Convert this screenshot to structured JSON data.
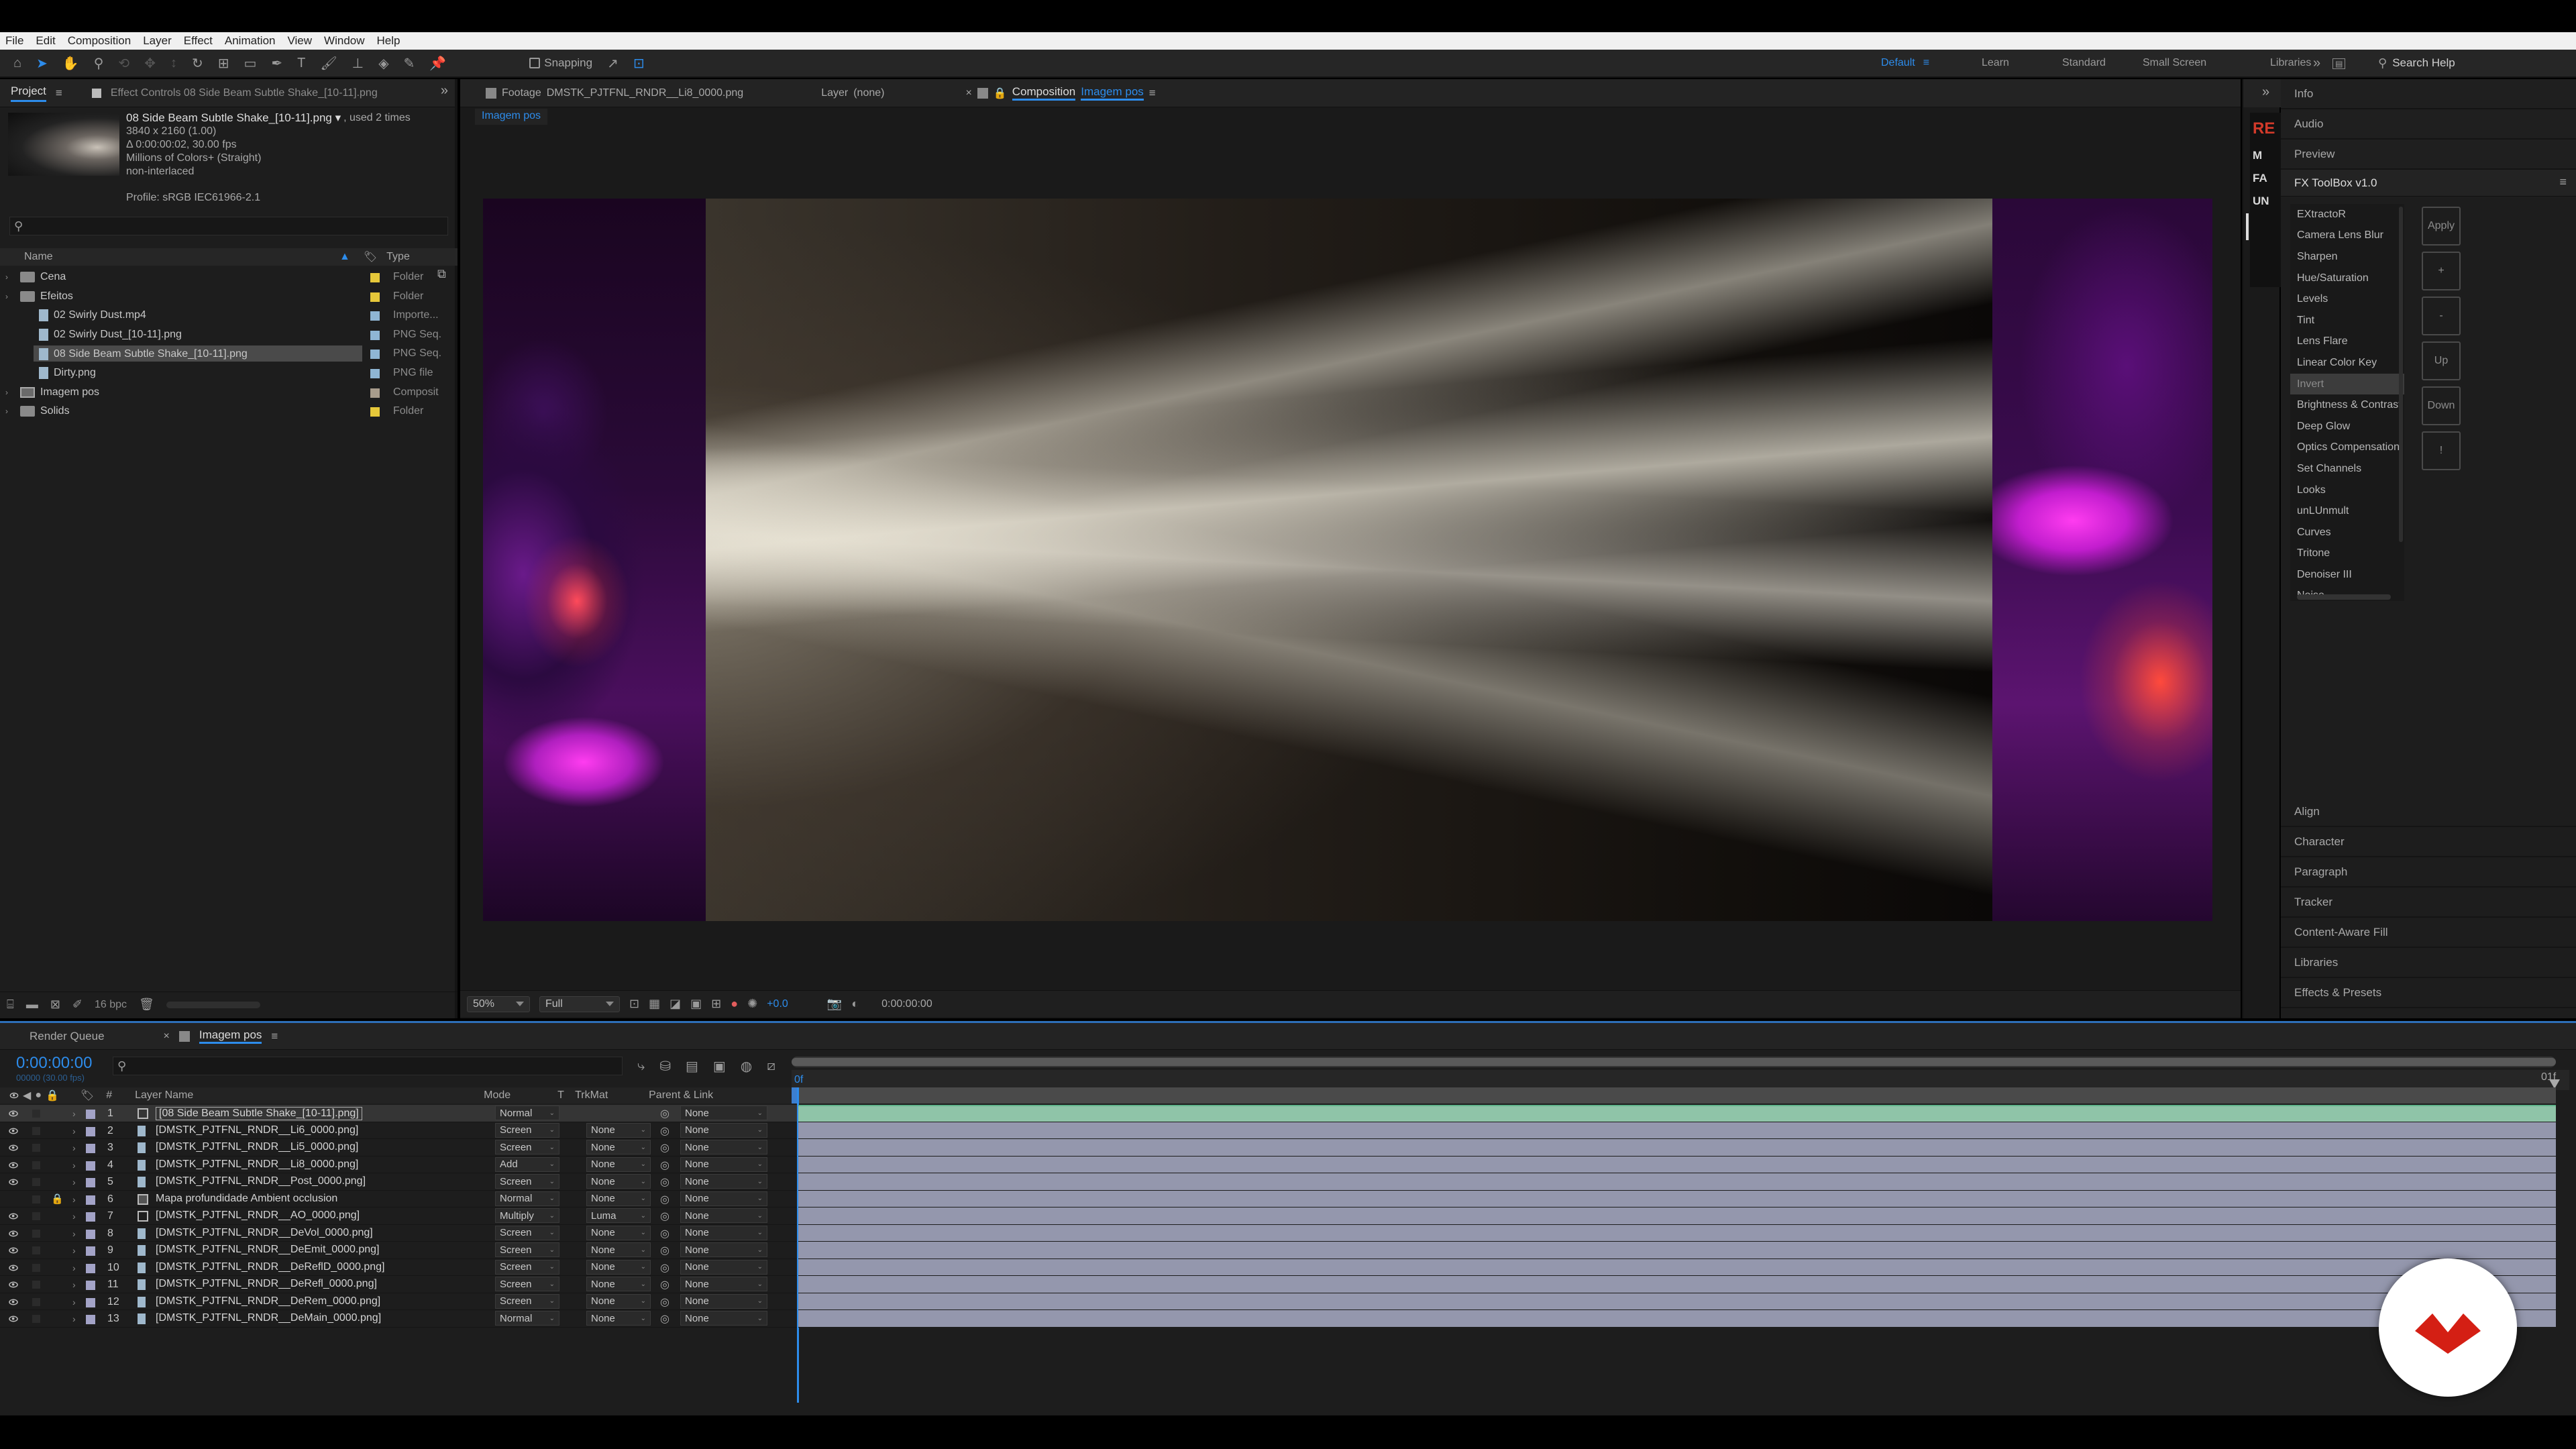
{
  "menubar": {
    "items": [
      "File",
      "Edit",
      "Composition",
      "Layer",
      "Effect",
      "Animation",
      "View",
      "Window",
      "Help"
    ]
  },
  "toolbar": {
    "snapping": "Snapping",
    "workspaces": [
      "Default",
      "Learn",
      "Standard",
      "Small Screen",
      "Libraries"
    ],
    "search_placeholder": "Search Help"
  },
  "project_panel": {
    "tab_project": "Project",
    "tab_effect_controls": "Effect Controls 08 Side Beam Subtle Shake_[10-11].png",
    "selected_name": "08 Side Beam Subtle Shake_[10-11].png ▾",
    "used_times": ", used 2 times",
    "info_lines": [
      "3840 x 2160 (1.00)",
      "Δ 0:00:00:02, 30.00 fps",
      "Millions of Colors+ (Straight)",
      "non-interlaced"
    ],
    "profile": "Profile: sRGB IEC61966-2.1",
    "col_name": "Name",
    "col_type": "Type",
    "items": [
      {
        "name": "Cena",
        "type": "Folder",
        "kind": "folder",
        "indent": 0,
        "color": "#e6c83a"
      },
      {
        "name": "Efeitos",
        "type": "Folder",
        "kind": "folder",
        "indent": 0,
        "color": "#e6c83a"
      },
      {
        "name": "02 Swirly Dust.mp4",
        "type": "Importe...",
        "kind": "file",
        "indent": 1,
        "color": "#8fb6d4"
      },
      {
        "name": "02 Swirly Dust_[10-11].png",
        "type": "PNG Seq.",
        "kind": "file",
        "indent": 1,
        "color": "#8fb6d4"
      },
      {
        "name": "08 Side Beam Subtle Shake_[10-11].png",
        "type": "PNG Seq.",
        "kind": "file",
        "indent": 1,
        "color": "#8fb6d4",
        "selected": true
      },
      {
        "name": "Dirty.png",
        "type": "PNG file",
        "kind": "file",
        "indent": 1,
        "color": "#8fb6d4"
      },
      {
        "name": "Imagem pos",
        "type": "Composit",
        "kind": "comp",
        "indent": 0,
        "color": "#a89c8c"
      },
      {
        "name": "Solids",
        "type": "Folder",
        "kind": "folder",
        "indent": 0,
        "color": "#e6c83a"
      }
    ],
    "bpc": "16 bpc"
  },
  "viewer": {
    "tab_footage_label": "Footage",
    "tab_footage_name": "DMSTK_PJTFNL_RNDR__Li8_0000.png",
    "tab_layer_label": "Layer",
    "tab_layer_name": "(none)",
    "tab_comp_label": "Composition",
    "tab_comp_name": "Imagem pos",
    "breadcrumb": "Imagem pos",
    "zoom": "50%",
    "resolution": "Full",
    "exposure": "+0.0",
    "timecode": "0:00:00:00"
  },
  "right_panel": {
    "top_sections": [
      "Info",
      "Audio",
      "Preview"
    ],
    "fx_title": "FX ToolBox v1.0",
    "fx_items": [
      "EXtractoR",
      "Camera Lens Blur",
      "Sharpen",
      "Hue/Saturation",
      "Levels",
      "Tint",
      "Lens Flare",
      "Linear Color Key",
      "Invert",
      "Brightness & Contrast",
      "Deep Glow",
      "Optics Compensation",
      "Set Channels",
      "Looks",
      "unLUnmult",
      "Curves",
      "Tritone",
      "Denoiser III",
      "Noise"
    ],
    "fx_selected": "Invert",
    "fx_buttons": [
      "Apply",
      "+",
      "-",
      "Up",
      "Down",
      "!"
    ],
    "bottom_sections": [
      "Align",
      "Character",
      "Paragraph",
      "Tracker",
      "Content-Aware Fill",
      "Libraries",
      "Effects & Presets"
    ],
    "strip_labels": [
      "RE",
      "M",
      "FA",
      "UN"
    ]
  },
  "timeline": {
    "tab_render_queue": "Render Queue",
    "tab_comp": "Imagem pos",
    "timecode": "0:00:00:00",
    "fps": "00000 (30.00 fps)",
    "headers": {
      "num": "#",
      "name": "Layer Name",
      "mode": "Mode",
      "t": "T",
      "trkmat": "TrkMat",
      "parent": "Parent & Link"
    },
    "ruler_start": "0f",
    "ruler_end": "01f",
    "layers": [
      {
        "num": "1",
        "name": "[08 Side Beam Subtle Shake_[10-11].png]",
        "mode": "Normal",
        "trkmat": "",
        "parent": "None",
        "color": "#a3a3c7",
        "icon": "seq",
        "selected": true,
        "eye": true
      },
      {
        "num": "2",
        "name": "[DMSTK_PJTFNL_RNDR__Li6_0000.png]",
        "mode": "Screen",
        "trkmat": "None",
        "parent": "None",
        "color": "#a3a3c7",
        "icon": "file",
        "eye": true
      },
      {
        "num": "3",
        "name": "[DMSTK_PJTFNL_RNDR__Li5_0000.png]",
        "mode": "Screen",
        "trkmat": "None",
        "parent": "None",
        "color": "#a3a3c7",
        "icon": "file",
        "eye": true
      },
      {
        "num": "4",
        "name": "[DMSTK_PJTFNL_RNDR__Li8_0000.png]",
        "mode": "Add",
        "trkmat": "None",
        "parent": "None",
        "color": "#a3a3c7",
        "icon": "file",
        "eye": true
      },
      {
        "num": "5",
        "name": "[DMSTK_PJTFNL_RNDR__Post_0000.png]",
        "mode": "Screen",
        "trkmat": "None",
        "parent": "None",
        "color": "#a3a3c7",
        "icon": "file",
        "eye": true
      },
      {
        "num": "6",
        "name": "Mapa profundidade Ambient occlusion",
        "mode": "Normal",
        "trkmat": "None",
        "parent": "None",
        "color": "#a3a3c7",
        "icon": "comp",
        "lock": true,
        "eye": false
      },
      {
        "num": "7",
        "name": "[DMSTK_PJTFNL_RNDR__AO_0000.png]",
        "mode": "Multiply",
        "trkmat": "Luma",
        "parent": "None",
        "color": "#a3a3c7",
        "icon": "seq",
        "eye": true
      },
      {
        "num": "8",
        "name": "[DMSTK_PJTFNL_RNDR__DeVol_0000.png]",
        "mode": "Screen",
        "trkmat": "None",
        "parent": "None",
        "color": "#a3a3c7",
        "icon": "file",
        "eye": true
      },
      {
        "num": "9",
        "name": "[DMSTK_PJTFNL_RNDR__DeEmit_0000.png]",
        "mode": "Screen",
        "trkmat": "None",
        "parent": "None",
        "color": "#a3a3c7",
        "icon": "file",
        "eye": true
      },
      {
        "num": "10",
        "name": "[DMSTK_PJTFNL_RNDR__DeReflD_0000.png]",
        "mode": "Screen",
        "trkmat": "None",
        "parent": "None",
        "color": "#a3a3c7",
        "icon": "file",
        "eye": true
      },
      {
        "num": "11",
        "name": "[DMSTK_PJTFNL_RNDR__DeRefl_0000.png]",
        "mode": "Screen",
        "trkmat": "None",
        "parent": "None",
        "color": "#a3a3c7",
        "icon": "file",
        "eye": true
      },
      {
        "num": "12",
        "name": "[DMSTK_PJTFNL_RNDR__DeRem_0000.png]",
        "mode": "Screen",
        "trkmat": "None",
        "parent": "None",
        "color": "#a3a3c7",
        "icon": "file",
        "eye": true
      },
      {
        "num": "13",
        "name": "[DMSTK_PJTFNL_RNDR__DeMain_0000.png]",
        "mode": "Normal",
        "trkmat": "None",
        "parent": "None",
        "color": "#a3a3c7",
        "icon": "file",
        "eye": true
      }
    ]
  },
  "colors": {
    "accent": "#2d8ceb",
    "selected_bar": "#8fc4a8",
    "layer_bar": "#9497ad",
    "logo_red": "#d41f14"
  }
}
